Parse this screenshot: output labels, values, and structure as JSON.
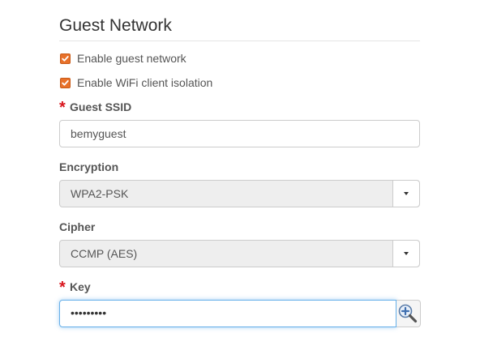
{
  "section": {
    "title": "Guest Network"
  },
  "checkboxes": {
    "enable_guest_label": "Enable guest network",
    "enable_guest_checked": true,
    "client_isolation_label": "Enable WiFi client isolation",
    "client_isolation_checked": true
  },
  "ssid": {
    "required_mark": "*",
    "label": "Guest SSID",
    "value": "bemyguest"
  },
  "encryption": {
    "label": "Encryption",
    "value": "WPA2-PSK"
  },
  "cipher": {
    "label": "Cipher",
    "value": "CCMP (AES)"
  },
  "key": {
    "required_mark": "*",
    "label": "Key",
    "value_masked": "•••••••••"
  },
  "icons": {
    "checkbox": "checkmark-icon",
    "dropdown": "caret-down-icon",
    "reveal": "magnifier-plus-icon"
  },
  "colors": {
    "checkbox_accent": "#e8712a",
    "required": "#d9161e",
    "focus_border": "#66afe9"
  }
}
